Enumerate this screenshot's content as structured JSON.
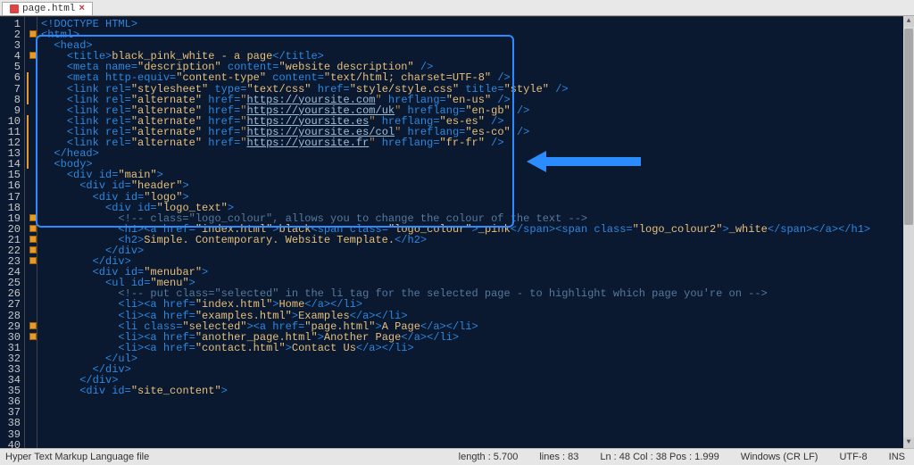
{
  "tab": {
    "label": "page.html"
  },
  "gutter": {
    "start": 1,
    "end": 40
  },
  "code_lines": [
    {
      "n": 1,
      "html": "<span class='t-tag'>&lt;!DOCTYPE HTML&gt;</span>"
    },
    {
      "n": 2,
      "html": "<span class='t-tag'>&lt;html&gt;</span>"
    },
    {
      "n": 3,
      "html": ""
    },
    {
      "n": 4,
      "html": "  <span class='t-tag'>&lt;head&gt;</span>"
    },
    {
      "n": 5,
      "html": "    <span class='t-tag'>&lt;title&gt;</span><span class='t-text'>black_pink_white - a page</span><span class='t-tag'>&lt;/title&gt;</span>"
    },
    {
      "n": 6,
      "html": "    <span class='t-tag'>&lt;meta</span> <span class='t-attr'>name=</span><span class='t-str'>\"description\"</span> <span class='t-attr'>content=</span><span class='t-str'>\"website description\"</span> <span class='t-tag'>/&gt;</span>"
    },
    {
      "n": 7,
      "html": "    <span class='t-tag'>&lt;meta</span> <span class='t-attr'>http-equiv=</span><span class='t-str'>\"content-type\"</span> <span class='t-attr'>content=</span><span class='t-str'>\"text/html; charset=UTF-8\"</span> <span class='t-tag'>/&gt;</span>"
    },
    {
      "n": 8,
      "html": "    <span class='t-tag'>&lt;link</span> <span class='t-attr'>rel=</span><span class='t-str'>\"stylesheet\"</span> <span class='t-attr'>type=</span><span class='t-str'>\"text/css\"</span> <span class='t-attr'>href=</span><span class='t-str'>\"style/style.css\"</span> <span class='t-attr'>title=</span><span class='t-str'>\"style\"</span> <span class='t-tag'>/&gt;</span>"
    },
    {
      "n": 9,
      "html": ""
    },
    {
      "n": 10,
      "html": "    <span class='t-tag'>&lt;link</span> <span class='t-attr'>rel=</span><span class='t-str'>\"alternate\"</span> <span class='t-attr'>href=</span><span class='t-strq'>\"</span><span class='t-link'>https://yoursite.com</span><span class='t-strq'>\"</span> <span class='t-attr'>hreflang=</span><span class='t-str'>\"en-us\"</span> <span class='t-tag'>/&gt;</span>"
    },
    {
      "n": 11,
      "html": "    <span class='t-tag'>&lt;link</span> <span class='t-attr'>rel=</span><span class='t-str'>\"alternate\"</span> <span class='t-attr'>href=</span><span class='t-strq'>\"</span><span class='t-link'>https://yoursite.com/uk</span><span class='t-strq'>\"</span> <span class='t-attr'>hreflang=</span><span class='t-str'>\"en-gb\"</span> <span class='t-tag'>/&gt;</span>"
    },
    {
      "n": 12,
      "html": "    <span class='t-tag'>&lt;link</span> <span class='t-attr'>rel=</span><span class='t-str'>\"alternate\"</span> <span class='t-attr'>href=</span><span class='t-strq'>\"</span><span class='t-link'>https://yoursite.es</span><span class='t-strq'>\"</span> <span class='t-attr'>hreflang=</span><span class='t-str'>\"es-es\"</span> <span class='t-tag'>/&gt;</span>"
    },
    {
      "n": 13,
      "html": "    <span class='t-tag'>&lt;link</span> <span class='t-attr'>rel=</span><span class='t-str'>\"alternate\"</span> <span class='t-attr'>href=</span><span class='t-strq'>\"</span><span class='t-link'>https://yoursite.es/col</span><span class='t-strq'>\"</span> <span class='t-attr'>hreflang=</span><span class='t-str'>\"es-co\"</span> <span class='t-tag'>/&gt;</span>"
    },
    {
      "n": 14,
      "html": "    <span class='t-tag'>&lt;link</span> <span class='t-attr'>rel=</span><span class='t-str'>\"alternate\"</span> <span class='t-attr'>href=</span><span class='t-strq'>\"</span><span class='t-link'>https://yoursite.fr</span><span class='t-strq'>\"</span> <span class='t-attr'>hreflang=</span><span class='t-str'>\"fr-fr\"</span> <span class='t-tag'>/&gt;</span>"
    },
    {
      "n": 15,
      "html": ""
    },
    {
      "n": 16,
      "html": ""
    },
    {
      "n": 17,
      "html": "  <span class='t-tag'>&lt;/head&gt;</span>"
    },
    {
      "n": 18,
      "html": ""
    },
    {
      "n": 19,
      "html": "  <span class='t-tag'>&lt;body&gt;</span>"
    },
    {
      "n": 20,
      "html": "    <span class='t-tag'>&lt;div</span> <span class='t-attr'>id=</span><span class='t-str'>\"main\"</span><span class='t-tag'>&gt;</span>"
    },
    {
      "n": 21,
      "html": "      <span class='t-tag'>&lt;div</span> <span class='t-attr'>id=</span><span class='t-str'>\"header\"</span><span class='t-tag'>&gt;</span>"
    },
    {
      "n": 22,
      "html": "        <span class='t-tag'>&lt;div</span> <span class='t-attr'>id=</span><span class='t-str'>\"logo\"</span><span class='t-tag'>&gt;</span>"
    },
    {
      "n": 23,
      "html": "          <span class='t-tag'>&lt;div</span> <span class='t-attr'>id=</span><span class='t-str'>\"logo_text\"</span><span class='t-tag'>&gt;</span>"
    },
    {
      "n": 24,
      "html": "            <span class='t-cmt'>&lt;!-- class=\"logo_colour\", allows you to change the colour of the text --&gt;</span>"
    },
    {
      "n": 25,
      "html": "            <span class='t-tag'>&lt;h1&gt;&lt;a</span> <span class='t-attr'>href=</span><span class='t-str'>\"index.html\"</span><span class='t-tag'>&gt;</span><span class='t-text'>black</span><span class='t-tag'>&lt;span</span> <span class='t-attr'>class=</span><span class='t-str'>\"logo_colour\"</span><span class='t-tag'>&gt;</span><span class='t-text'>_pink</span><span class='t-tag'>&lt;/span&gt;&lt;span</span> <span class='t-attr'>class=</span><span class='t-str'>\"logo_colour2\"</span><span class='t-tag'>&gt;</span><span class='t-text'>_white</span><span class='t-tag'>&lt;/span&gt;&lt;/a&gt;&lt;/h1&gt;</span>"
    },
    {
      "n": 26,
      "html": "            <span class='t-tag'>&lt;h2&gt;</span><span class='t-text'>Simple. Contemporary. Website Template.</span><span class='t-tag'>&lt;/h2&gt;</span>"
    },
    {
      "n": 27,
      "html": "          <span class='t-tag'>&lt;/div&gt;</span>"
    },
    {
      "n": 28,
      "html": "        <span class='t-tag'>&lt;/div&gt;</span>"
    },
    {
      "n": 29,
      "html": "        <span class='t-tag'>&lt;div</span> <span class='t-attr'>id=</span><span class='t-str'>\"menubar\"</span><span class='t-tag'>&gt;</span>"
    },
    {
      "n": 30,
      "html": "          <span class='t-tag'>&lt;ul</span> <span class='t-attr'>id=</span><span class='t-str'>\"menu\"</span><span class='t-tag'>&gt;</span>"
    },
    {
      "n": 31,
      "html": "            <span class='t-cmt'>&lt;!-- put class=\"selected\" in the li tag for the selected page - to highlight which page you're on --&gt;</span>"
    },
    {
      "n": 32,
      "html": "            <span class='t-tag'>&lt;li&gt;&lt;a</span> <span class='t-attr'>href=</span><span class='t-str'>\"index.html\"</span><span class='t-tag'>&gt;</span><span class='t-text'>Home</span><span class='t-tag'>&lt;/a&gt;&lt;/li&gt;</span>"
    },
    {
      "n": 33,
      "html": "            <span class='t-tag'>&lt;li&gt;&lt;a</span> <span class='t-attr'>href=</span><span class='t-str'>\"examples.html\"</span><span class='t-tag'>&gt;</span><span class='t-text'>Examples</span><span class='t-tag'>&lt;/a&gt;&lt;/li&gt;</span>"
    },
    {
      "n": 34,
      "html": "            <span class='t-tag'>&lt;li</span> <span class='t-attr'>class=</span><span class='t-str'>\"selected\"</span><span class='t-tag'>&gt;&lt;a</span> <span class='t-attr'>href=</span><span class='t-str'>\"page.html\"</span><span class='t-tag'>&gt;</span><span class='t-text'>A Page</span><span class='t-tag'>&lt;/a&gt;&lt;/li&gt;</span>"
    },
    {
      "n": 35,
      "html": "            <span class='t-tag'>&lt;li&gt;&lt;a</span> <span class='t-attr'>href=</span><span class='t-str'>\"another_page.html\"</span><span class='t-tag'>&gt;</span><span class='t-text'>Another Page</span><span class='t-tag'>&lt;/a&gt;&lt;/li&gt;</span>"
    },
    {
      "n": 36,
      "html": "            <span class='t-tag'>&lt;li&gt;&lt;a</span> <span class='t-attr'>href=</span><span class='t-str'>\"contact.html\"</span><span class='t-tag'>&gt;</span><span class='t-text'>Contact Us</span><span class='t-tag'>&lt;/a&gt;&lt;/li&gt;</span>"
    },
    {
      "n": 37,
      "html": "          <span class='t-tag'>&lt;/ul&gt;</span>"
    },
    {
      "n": 38,
      "html": "        <span class='t-tag'>&lt;/div&gt;</span>"
    },
    {
      "n": 39,
      "html": "      <span class='t-tag'>&lt;/div&gt;</span>"
    },
    {
      "n": 40,
      "html": "      <span class='t-tag'>&lt;div</span> <span class='t-attr'>id=</span><span class='t-str'>\"site_content\"</span><span class='t-tag'>&gt;</span>"
    }
  ],
  "fold_lines": [
    2,
    4,
    19,
    20,
    21,
    22,
    23,
    29,
    30
  ],
  "mod_lines": [
    [
      6,
      8
    ],
    [
      10,
      14
    ]
  ],
  "status": {
    "filetype": "Hyper Text Markup Language file",
    "length": "length : 5.700",
    "lines": "lines : 83",
    "pos": "Ln : 48   Col : 38   Pos : 1.999",
    "eol": "Windows (CR LF)",
    "enc": "UTF-8",
    "mode": "INS"
  }
}
